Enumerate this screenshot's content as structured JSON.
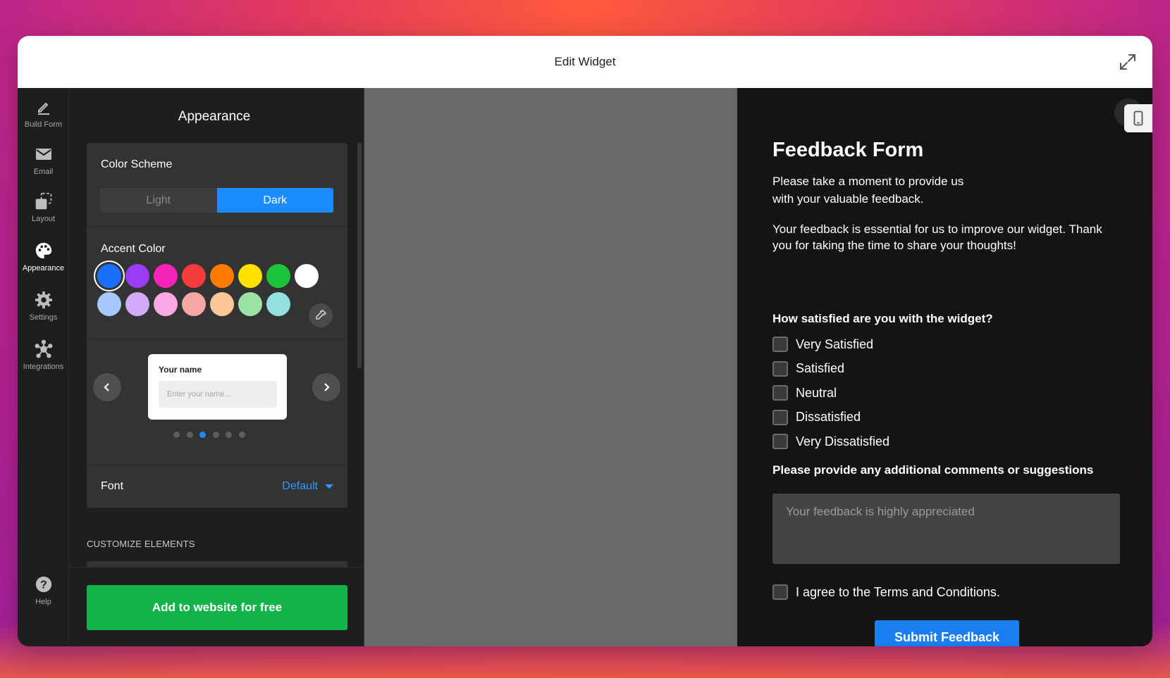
{
  "window": {
    "title": "Edit Widget"
  },
  "nav": {
    "items": [
      {
        "label": "Build Form",
        "icon": "pencil-icon"
      },
      {
        "label": "Email",
        "icon": "envelope-icon"
      },
      {
        "label": "Layout",
        "icon": "layout-icon"
      },
      {
        "label": "Appearance",
        "icon": "palette-icon",
        "active": true
      },
      {
        "label": "Settings",
        "icon": "gear-icon"
      },
      {
        "label": "Integrations",
        "icon": "integrations-icon"
      }
    ],
    "help_label": "Help"
  },
  "panel": {
    "title": "Appearance",
    "color_scheme": {
      "label": "Color Scheme",
      "options": [
        "Light",
        "Dark"
      ],
      "selected": "Dark"
    },
    "accent_color": {
      "label": "Accent Color",
      "row1": [
        "#1a6fff",
        "#9b3cf5",
        "#f523b7",
        "#f53b3b",
        "#ff7b00",
        "#ffe100",
        "#1cc43b",
        "#ffffff"
      ],
      "row2": [
        "#a5c9ff",
        "#d3aaf8",
        "#f9a8e4",
        "#f8a5a5",
        "#fcc797",
        "#9be3a2",
        "#93e1dd"
      ],
      "selected": "#1a6fff"
    },
    "preview_card": {
      "label": "Your name",
      "placeholder": "Enter your name..."
    },
    "carousel": {
      "count": 6,
      "active_index": 2
    },
    "font": {
      "label": "Font",
      "value": "Default"
    },
    "customize_label": "CUSTOMIZE ELEMENTS",
    "add_button": "Add to website for free"
  },
  "form": {
    "title": "Feedback Form",
    "intro": "Please take a moment to provide us with your valuable feedback.",
    "description": "Your feedback is essential for us to improve our widget. Thank you for taking the time to share your thoughts!",
    "question1": "How satisfied are you with the widget?",
    "options": [
      "Very Satisfied",
      "Satisfied",
      "Neutral",
      "Dissatisfied",
      "Very Dissatisfied"
    ],
    "question2": "Please provide any additional comments or suggestions",
    "textarea_placeholder": "Your feedback is highly appreciated",
    "terms": "I agree to the Terms and Conditions.",
    "submit": "Submit Feedback"
  }
}
